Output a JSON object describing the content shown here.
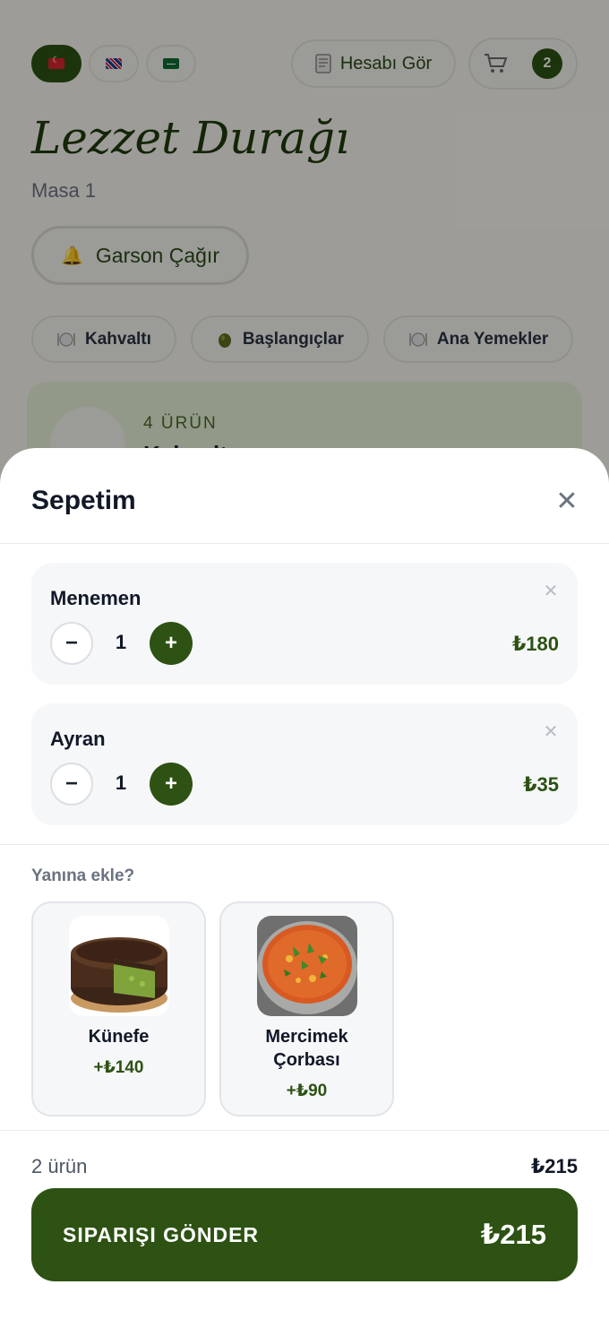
{
  "header": {
    "languages": [
      {
        "code": "tr",
        "icon": "turkey-flag-icon",
        "active": true
      },
      {
        "code": "en",
        "icon": "uk-flag-icon",
        "active": false
      },
      {
        "code": "ar",
        "icon": "saudi-flag-icon",
        "active": false
      }
    ],
    "account_label": "Hesabı Gör",
    "cart_count": "2"
  },
  "restaurant": {
    "name": "Lezzet Durağı",
    "table": "Masa 1",
    "call_waiter_label": "Garson Çağır"
  },
  "categories": [
    {
      "label": "Kahvaltı",
      "icon": "plate-icon"
    },
    {
      "label": "Başlangıçlar",
      "icon": "olive-icon"
    },
    {
      "label": "Ana Yemekler",
      "icon": "plate-icon"
    }
  ],
  "section": {
    "count_label": "4 ÜRÜN",
    "title": "Kahvaltı"
  },
  "cart": {
    "title": "Sepetim",
    "items": [
      {
        "name": "Menemen",
        "qty": "1",
        "price": "₺180"
      },
      {
        "name": "Ayran",
        "qty": "1",
        "price": "₺35"
      }
    ],
    "upsell_label": "Yanına ekle?",
    "upsell": [
      {
        "name": "Künefe",
        "price": "+₺140"
      },
      {
        "name": "Mercimek Çorbası",
        "price": "+₺90"
      }
    ],
    "footer_count": "2 ürün",
    "footer_total": "₺215",
    "submit_label": "SIPARIŞI GÖNDER",
    "submit_total": "₺215"
  },
  "colors": {
    "brand_green": "#2d5213",
    "section_bg": "#e4efd6"
  }
}
